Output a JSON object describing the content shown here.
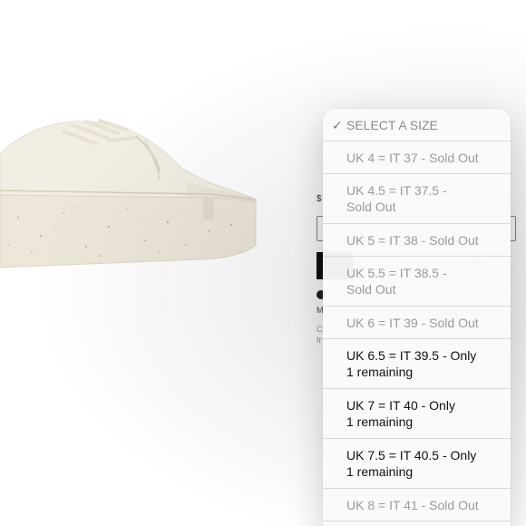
{
  "product": {
    "price_fragment": "$",
    "frag_m": "M",
    "frag_c": "C",
    "frag_fr": "fr"
  },
  "size_picker": {
    "options": [
      {
        "label": "SELECT A SIZE",
        "selected": true,
        "available": false
      },
      {
        "label": "UK 4 = IT 37 - Sold Out",
        "selected": false,
        "available": false
      },
      {
        "label": "UK 4.5 = IT 37.5 -\nSold Out",
        "selected": false,
        "available": false
      },
      {
        "label": "UK 5 = IT 38 - Sold Out",
        "selected": false,
        "available": false
      },
      {
        "label": "UK 5.5 = IT 38.5 -\nSold Out",
        "selected": false,
        "available": false
      },
      {
        "label": "UK 6 = IT 39 - Sold Out",
        "selected": false,
        "available": false
      },
      {
        "label": "UK 6.5 = IT 39.5 - Only\n1 remaining",
        "selected": false,
        "available": true
      },
      {
        "label": "UK 7 = IT 40 - Only\n1 remaining",
        "selected": false,
        "available": true
      },
      {
        "label": "UK 7.5 = IT 40.5 - Only\n1 remaining",
        "selected": false,
        "available": true
      },
      {
        "label": "UK 8 = IT 41 - Sold Out",
        "selected": false,
        "available": false
      }
    ],
    "checkmark": "✓"
  },
  "colors": {
    "sneaker": "#efeadb",
    "sole": "#e8e2d2",
    "speckle": "#b9a98a"
  }
}
